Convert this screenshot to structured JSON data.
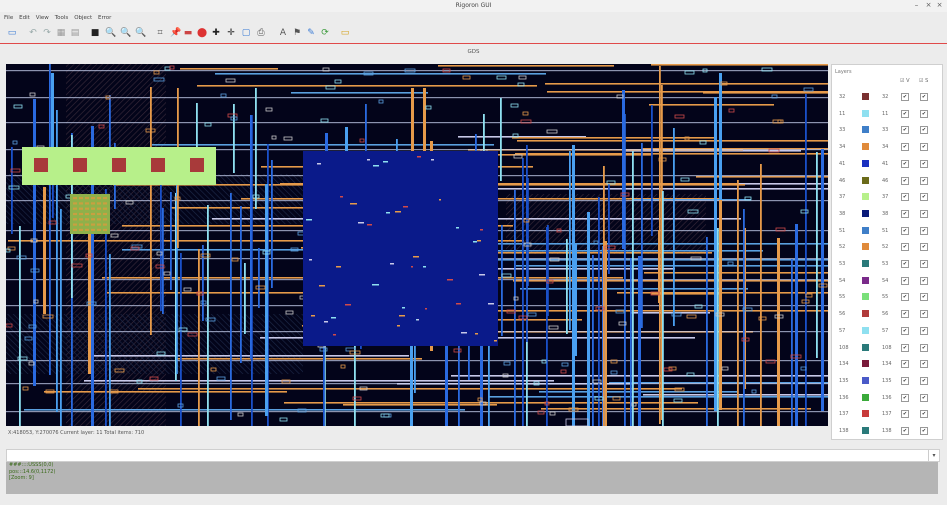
{
  "window": {
    "title": "Rigoron GUI",
    "controls": [
      "–",
      "×",
      "×"
    ]
  },
  "menu": [
    "File",
    "Edit",
    "View",
    "Tools",
    "Object",
    "Error"
  ],
  "toolbar": [
    {
      "name": "save-icon",
      "glyph": "▭",
      "color": "#3a7bd5"
    },
    {
      "name": "undo-icon",
      "glyph": "↶",
      "color": "#9aa"
    },
    {
      "name": "redo-icon",
      "glyph": "↷",
      "color": "#9aa"
    },
    {
      "name": "grid-icon",
      "glyph": "▦",
      "color": "#999"
    },
    {
      "name": "layers-icon",
      "glyph": "▤",
      "color": "#999"
    },
    {
      "name": "fit-icon",
      "glyph": "■",
      "color": "#222"
    },
    {
      "name": "zoom-in-icon",
      "glyph": "🔍",
      "color": "#333"
    },
    {
      "name": "zoom-out-icon",
      "glyph": "🔍",
      "color": "#333"
    },
    {
      "name": "zoom-icon",
      "glyph": "🔍",
      "color": "#333"
    },
    {
      "name": "crosshair-icon",
      "glyph": "⌗",
      "color": "#555"
    },
    {
      "name": "pin-icon",
      "glyph": "📌",
      "color": "#c33"
    },
    {
      "name": "ruler-icon",
      "glyph": "▬",
      "color": "#c44"
    },
    {
      "name": "marker-icon",
      "glyph": "⬤",
      "color": "#d33"
    },
    {
      "name": "move-icon",
      "glyph": "✚",
      "color": "#222"
    },
    {
      "name": "add-icon",
      "glyph": "✛",
      "color": "#222"
    },
    {
      "name": "window-icon",
      "glyph": "▢",
      "color": "#3a7bd5"
    },
    {
      "name": "print-icon",
      "glyph": "⎙",
      "color": "#555"
    },
    {
      "name": "text-icon",
      "glyph": "A",
      "color": "#555"
    },
    {
      "name": "flag-icon",
      "glyph": "⚑",
      "color": "#555"
    },
    {
      "name": "pencil-icon",
      "glyph": "✎",
      "color": "#3a7bd5"
    },
    {
      "name": "refresh-icon",
      "glyph": "⟳",
      "color": "#3a9a3a"
    },
    {
      "name": "folder-icon",
      "glyph": "▭",
      "color": "#d4a017"
    }
  ],
  "tab": "GDS",
  "status": "X:418053, Y:270076  Current layer: 11  Total items: 710",
  "layer_panel": {
    "title": "Layers",
    "col_v": "V",
    "col_s": "S",
    "rows": [
      {
        "id": "32",
        "color": "#7a3030"
      },
      {
        "id": "11",
        "color": "#8fe0f0"
      },
      {
        "id": "33",
        "color": "#3f7fc8"
      },
      {
        "id": "34",
        "color": "#e08a3a"
      },
      {
        "id": "41",
        "color": "#1a30c0"
      },
      {
        "id": "46",
        "color": "#6b6b1a"
      },
      {
        "id": "37",
        "color": "#b7f08a"
      },
      {
        "id": "38",
        "color": "#0a1a7a"
      },
      {
        "id": "51",
        "color": "#3f7fc8"
      },
      {
        "id": "52",
        "color": "#e08a3a"
      },
      {
        "id": "53",
        "color": "#2a7a7a"
      },
      {
        "id": "54",
        "color": "#7a2a8a"
      },
      {
        "id": "55",
        "color": "#7ae07a"
      },
      {
        "id": "56",
        "color": "#b03a3a"
      },
      {
        "id": "57",
        "color": "#8fe0f0"
      },
      {
        "id": "108",
        "color": "#2a7a7a"
      },
      {
        "id": "134",
        "color": "#7a1a3a"
      },
      {
        "id": "135",
        "color": "#4a5ac8"
      },
      {
        "id": "136",
        "color": "#3aaa3a"
      },
      {
        "id": "137",
        "color": "#c83a3a"
      },
      {
        "id": "138",
        "color": "#2a7a7a"
      }
    ]
  },
  "command": {
    "value": ""
  },
  "console": [
    "###::::USSS(0,0)",
    "pos:::14.6(0,1172)",
    "[Zoom: 9]"
  ],
  "colors": {
    "canvas_bg": "#03041a",
    "macro_fill": "#0a1a8a",
    "pad_strip": "#b7f08a",
    "pad": "#a83a3a"
  }
}
